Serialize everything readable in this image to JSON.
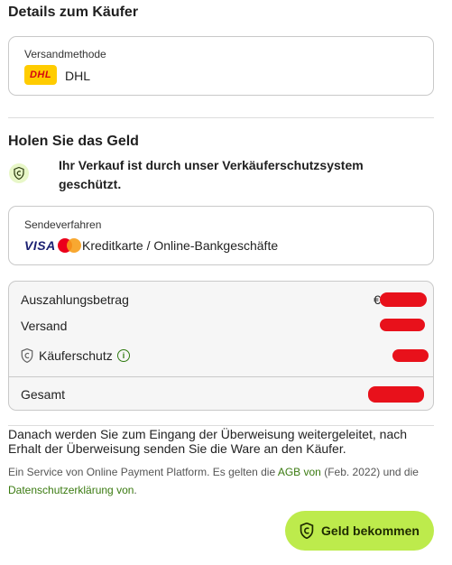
{
  "buyer_section": {
    "title": "Details zum Käufer",
    "shipping_label": "Versandmethode",
    "shipping_value": "DHL",
    "shipping_logo_text": "DHL"
  },
  "payout_section": {
    "title": "Holen Sie das Geld",
    "protection_notice": "Ihr Verkauf ist durch unser Verkäuferschutzsystem geschützt.",
    "method_label": "Sendeverfahren",
    "visa_text": "VISA",
    "method_value": "Kreditkarte / Online-Bankgeschäfte"
  },
  "summary": {
    "rows": [
      {
        "label": "Auszahlungsbetrag",
        "prefix": "€"
      },
      {
        "label": "Versand",
        "prefix": ""
      },
      {
        "label": "Käuferschutz",
        "prefix": ""
      }
    ],
    "total_label": "Gesamt"
  },
  "redirect_notice": "Danach werden Sie zum Eingang der Überweisung weitergeleitet, nach Erhalt der Überweisung senden Sie die Ware an den Käufer.",
  "footer": {
    "text_1": "Ein Service von Online Payment Platform. Es gelten die",
    "agb_link": "AGB von",
    "text_2": "(Feb. 2022) und die",
    "privacy_link": "Datenschutzerklärung von",
    "text_3": "."
  },
  "cta": {
    "label": "Geld bekommen"
  },
  "colors": {
    "accent": "#bdeb4c",
    "link": "#3a7a10",
    "dhl_yellow": "#ffcc00",
    "dhl_red": "#d40511"
  }
}
